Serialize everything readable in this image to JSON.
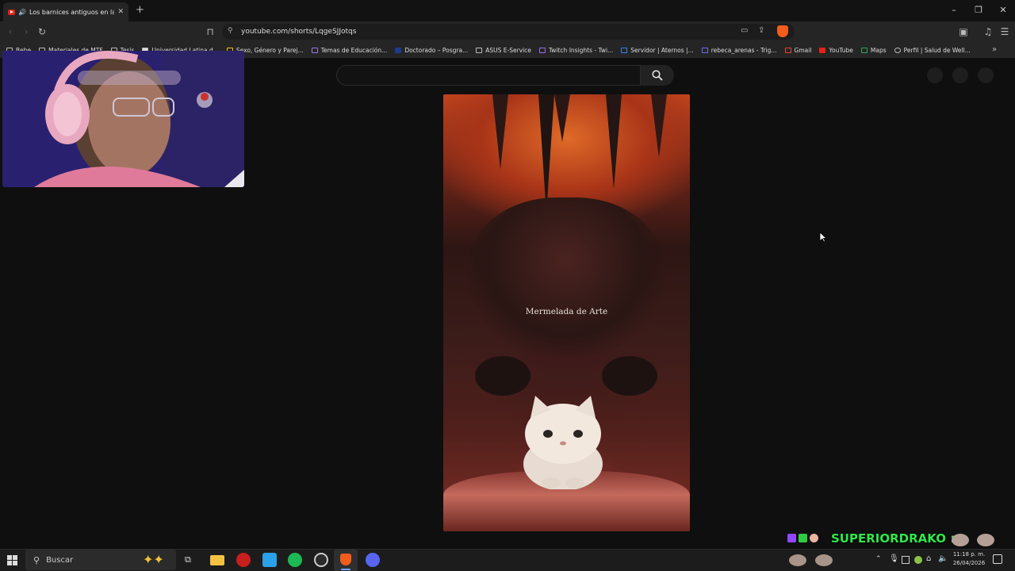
{
  "browser": {
    "tab_title": "Los barnices antiguos en las p",
    "url": "youtube.com/shorts/LqgeSJJotqs",
    "new_tab_symbol": "+",
    "bookmarks": [
      "Bebe",
      "Materiales de MTF",
      "Tesis",
      "Universidad Latina d...",
      "Sexo, Género y Parej...",
      "Temas de Educación...",
      "Doctorado – Posgra...",
      "ASUS E-Service",
      "Twitch Insights - Twi...",
      "Servidor | Aternos |...",
      "rebeca_arenas - Trig...",
      "Gmail",
      "YouTube",
      "Maps",
      "Perfil | Salud de Well..."
    ],
    "bookmarks_more": "»"
  },
  "video": {
    "overlay_text": "Mermelada de Arte"
  },
  "overlay": {
    "username": "SUPERIORDRAKO",
    "separator": ":"
  },
  "taskbar": {
    "search_placeholder": "Buscar",
    "time": "11:18 p. m.",
    "date": "26/04/2026"
  },
  "colors": {
    "page_bg": "#0f0f0f",
    "chat_name": "#2ee84a",
    "youtube_red": "#e62117"
  }
}
